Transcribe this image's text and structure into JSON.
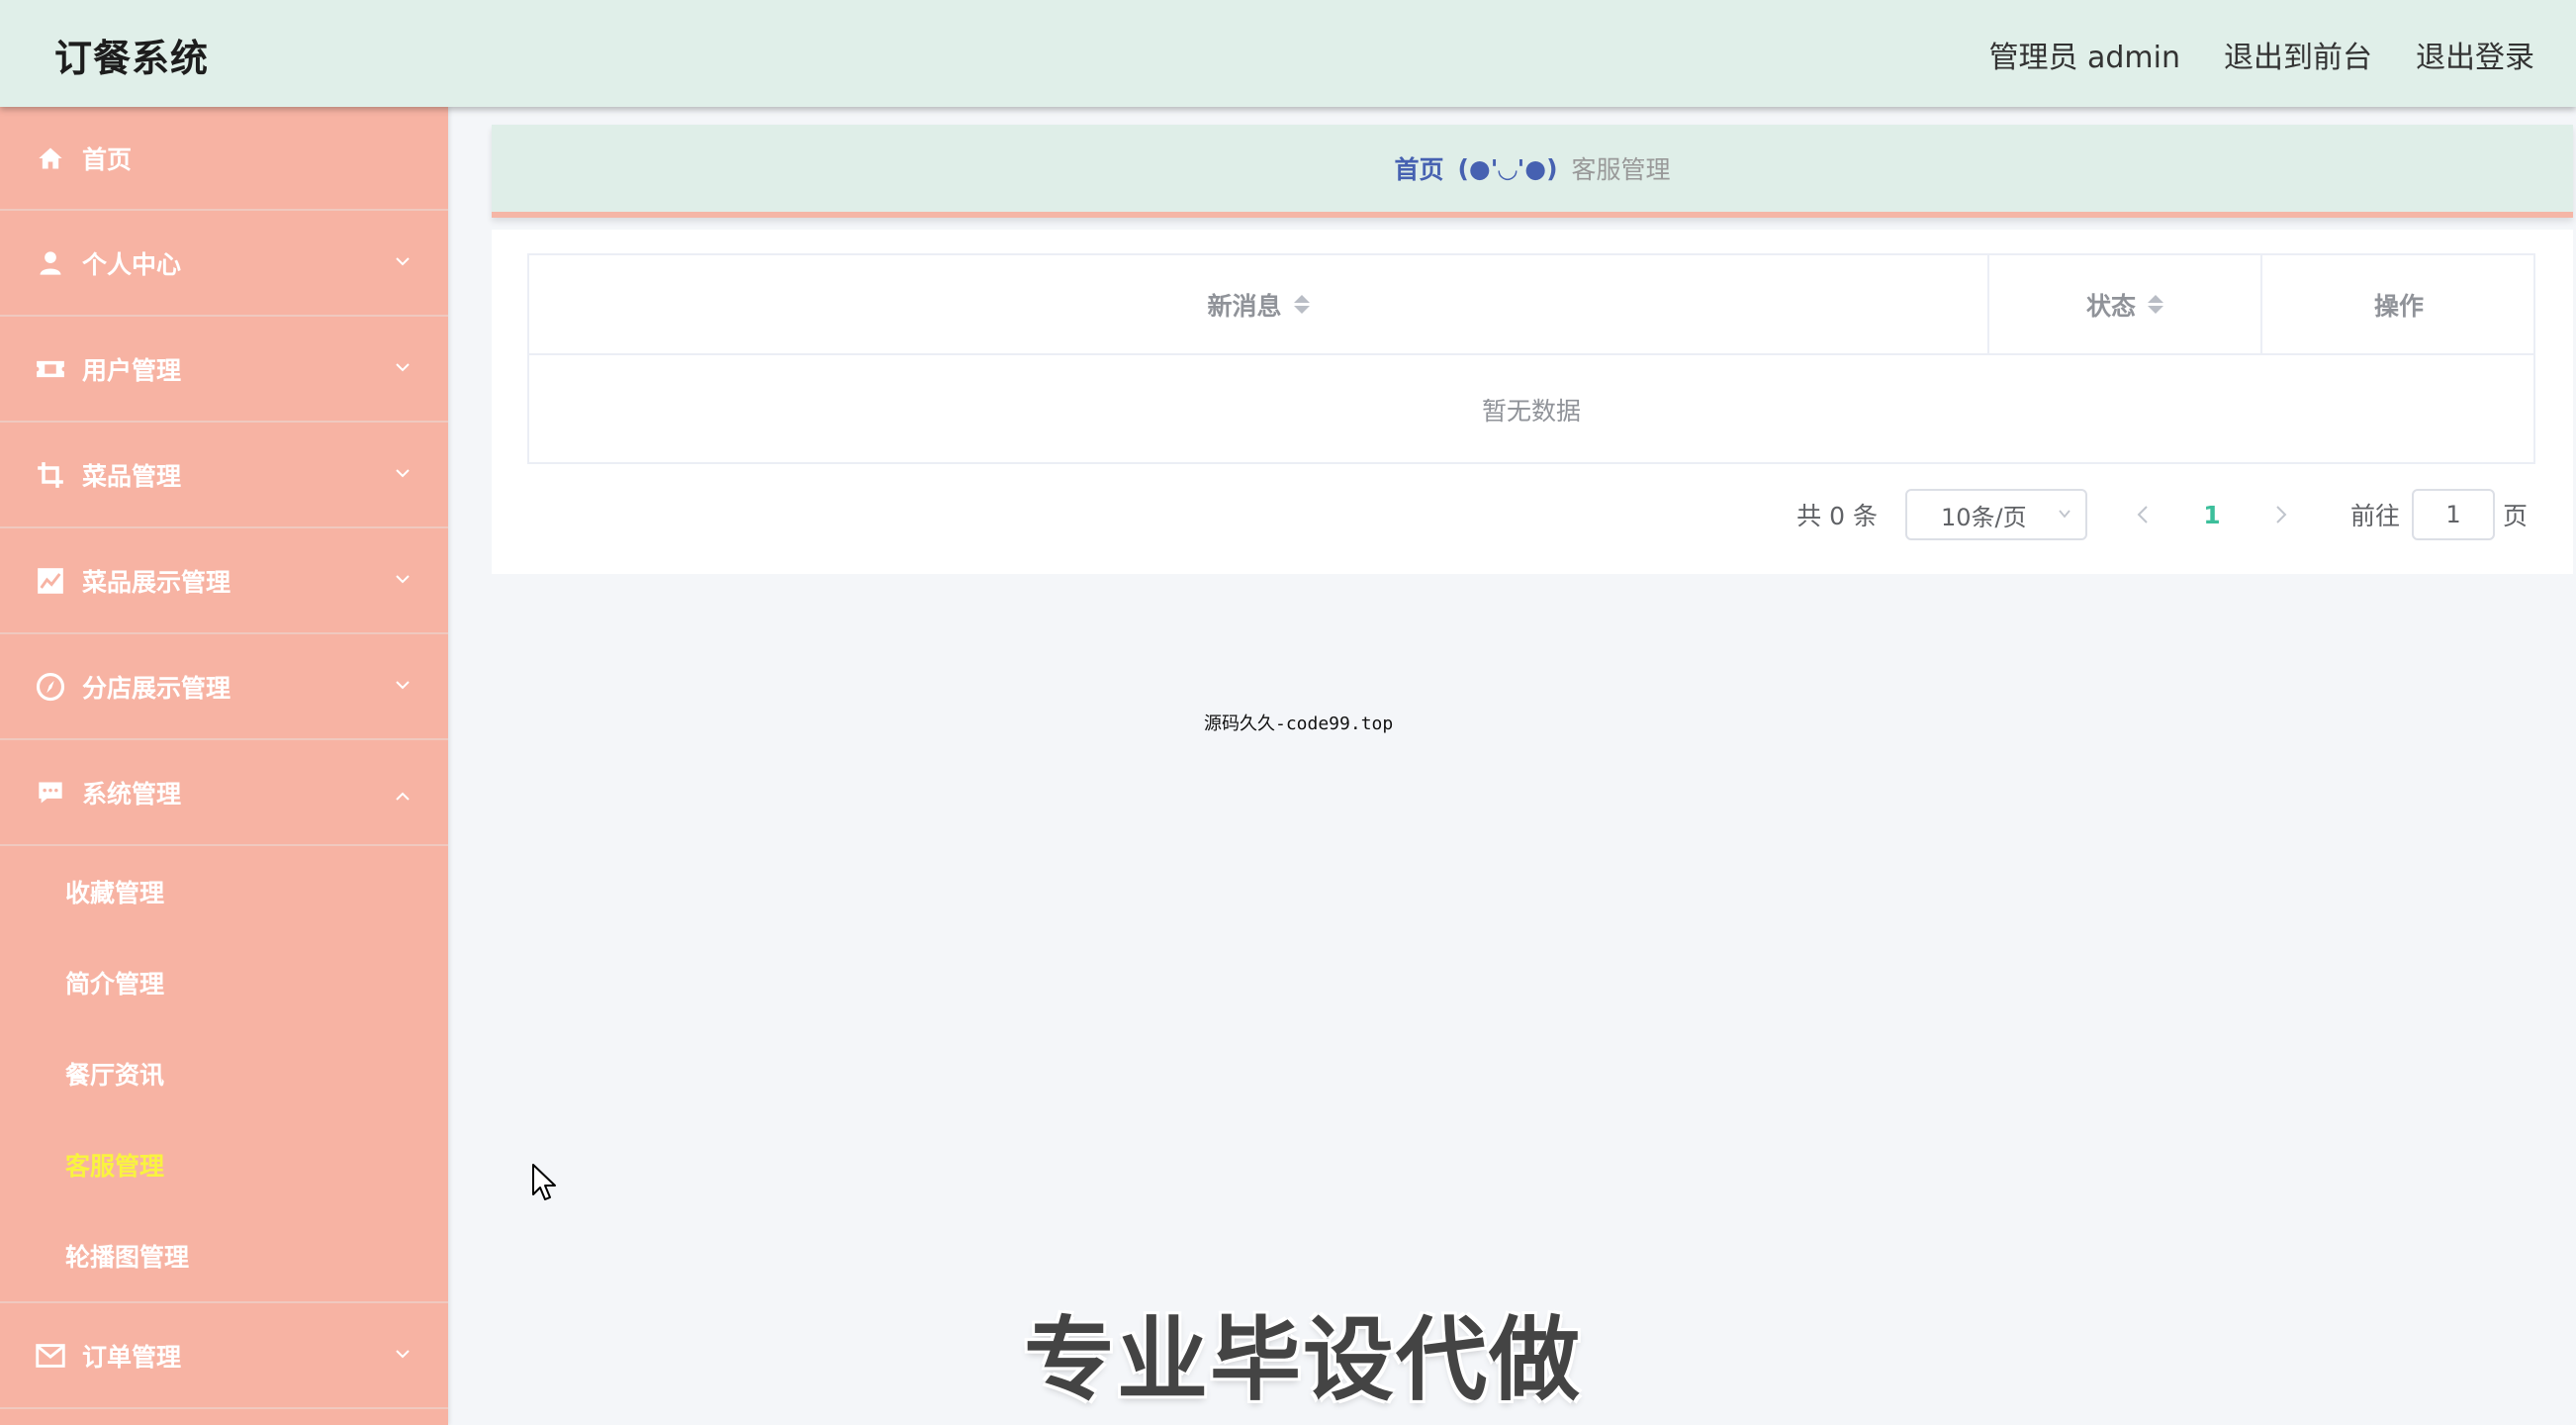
{
  "app": {
    "title": "订餐系统"
  },
  "header": {
    "user_label": "管理员 admin",
    "front_link": "退出到前台",
    "logout_link": "退出登录"
  },
  "sidebar": {
    "items": [
      {
        "label": "首页",
        "icon": "home-icon"
      },
      {
        "label": "个人中心",
        "icon": "user-icon"
      },
      {
        "label": "用户管理",
        "icon": "ticket-icon"
      },
      {
        "label": "菜品管理",
        "icon": "crop-icon"
      },
      {
        "label": "菜品展示管理",
        "icon": "chart-icon"
      },
      {
        "label": "分店展示管理",
        "icon": "compass-icon"
      },
      {
        "label": "系统管理",
        "icon": "chat-icon"
      },
      {
        "label": "订单管理",
        "icon": "mail-icon"
      }
    ],
    "system_submenu": [
      {
        "label": "收藏管理"
      },
      {
        "label": "简介管理"
      },
      {
        "label": "餐厅资讯"
      },
      {
        "label": "客服管理"
      },
      {
        "label": "轮播图管理"
      }
    ],
    "active_submenu": "客服管理"
  },
  "breadcrumb": {
    "home": "首页",
    "separator": "(●'◡'●)",
    "current": "客服管理"
  },
  "table": {
    "columns": [
      "新消息",
      "状态",
      "操作"
    ],
    "rows": [],
    "empty_text": "暂无数据"
  },
  "pagination": {
    "total_text": "共 0 条",
    "page_size": "10条/页",
    "current_page": "1",
    "goto_label": "前往",
    "goto_value": "1",
    "page_suffix": "页"
  },
  "overlays": {
    "watermark": "源码久久-code99.top",
    "promo": "专业毕设代做"
  },
  "colors": {
    "header_bg": "#e0efe9",
    "sidebar_bg": "#f7b3a3",
    "active_sub": "#f9f33f",
    "breadcrumb_link": "#4661b1",
    "page_active": "#3cbf9b"
  }
}
